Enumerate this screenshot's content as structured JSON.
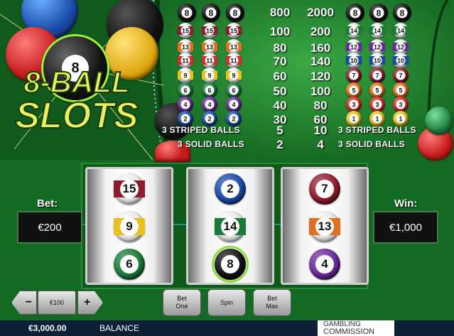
{
  "game": {
    "title_line1": "8-BALL",
    "title_line2": "SLOTS",
    "logo_ball_number": "8"
  },
  "paytable": {
    "rows": [
      {
        "ball": "8",
        "color": "#111111",
        "stripe": false,
        "p1": "800",
        "p2": "2000"
      },
      {
        "ball": "15",
        "color": "#8e1b2e",
        "stripe": true,
        "p1": "100",
        "p2": "200",
        "right_ball": "14",
        "right_color": "#1a7a3a",
        "right_stripe": true
      },
      {
        "ball": "13",
        "color": "#e07020",
        "stripe": true,
        "p1": "80",
        "p2": "160",
        "right_ball": "12",
        "right_color": "#6a2a9a",
        "right_stripe": true
      },
      {
        "ball": "11",
        "color": "#d42a2a",
        "stripe": true,
        "p1": "70",
        "p2": "140",
        "right_ball": "10",
        "right_color": "#1a4aa8",
        "right_stripe": true
      },
      {
        "ball": "9",
        "color": "#e8c020",
        "stripe": true,
        "p1": "60",
        "p2": "120",
        "right_ball": "7",
        "right_color": "#8e1b2e",
        "right_stripe": false
      },
      {
        "ball": "6",
        "color": "#1a7a3a",
        "stripe": false,
        "p1": "50",
        "p2": "100",
        "right_ball": "5",
        "right_color": "#e07020",
        "right_stripe": false
      },
      {
        "ball": "4",
        "color": "#6a2a9a",
        "stripe": false,
        "p1": "40",
        "p2": "80",
        "right_ball": "3",
        "right_color": "#d42a2a",
        "right_stripe": false
      },
      {
        "ball": "2",
        "color": "#1a4aa8",
        "stripe": false,
        "p1": "30",
        "p2": "60",
        "right_ball": "1",
        "right_color": "#e8c020",
        "right_stripe": false
      }
    ],
    "striped": {
      "left": "3 STRIPED BALLS",
      "p1": "5",
      "p2": "10",
      "right": "3 STRIPED BALLS"
    },
    "solid": {
      "left": "3 SOLID BALLS",
      "p1": "2",
      "p2": "4",
      "right": "3 SOLID BALLS"
    }
  },
  "reels": [
    [
      {
        "n": "15",
        "color": "#8e1b2e",
        "stripe": true
      },
      {
        "n": "9",
        "color": "#e8c020",
        "stripe": true
      },
      {
        "n": "6",
        "color": "#1a7a3a",
        "stripe": false
      }
    ],
    [
      {
        "n": "2",
        "color": "#1a4aa8",
        "stripe": false
      },
      {
        "n": "14",
        "color": "#1a7a3a",
        "stripe": true
      },
      {
        "n": "8",
        "color": "#111111",
        "stripe": false,
        "highlight": true
      }
    ],
    [
      {
        "n": "7",
        "color": "#8e1b2e",
        "stripe": false
      },
      {
        "n": "13",
        "color": "#e07020",
        "stripe": true
      },
      {
        "n": "4",
        "color": "#6a2a9a",
        "stripe": false
      }
    ]
  ],
  "bet": {
    "label": "Bet:",
    "value": "€200"
  },
  "win": {
    "label": "Win:",
    "value": "€1,000"
  },
  "controls": {
    "decrease": "−",
    "stake": "€100",
    "increase": "+",
    "bet_one": "Bet One",
    "spin": "Spin",
    "bet_max": "Bet Max"
  },
  "footer": {
    "balance_amount": "€3,000.00",
    "balance_label": "BALANCE",
    "gc_line1": "GAMBLING",
    "gc_line2": "COMMISSION"
  }
}
